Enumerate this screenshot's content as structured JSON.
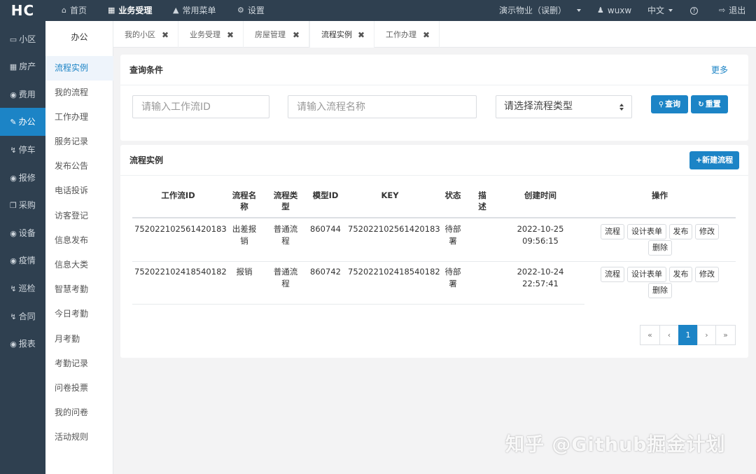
{
  "app": {
    "logo": "HC"
  },
  "topnav": {
    "home": "首页",
    "business": "业务受理",
    "common_menu": "常用菜单",
    "settings": "设置",
    "company": "演示物业（误删）",
    "user": "wuxw",
    "language": "中文",
    "logout": "退出"
  },
  "sidebar": {
    "items": [
      {
        "label": "小区",
        "icon": "monitor-icon"
      },
      {
        "label": "房产",
        "icon": "grid-icon"
      },
      {
        "label": "费用",
        "icon": "globe-icon"
      },
      {
        "label": "办公",
        "icon": "edit-icon"
      },
      {
        "label": "停车",
        "icon": "bolt-icon"
      },
      {
        "label": "报修",
        "icon": "globe-icon"
      },
      {
        "label": "采购",
        "icon": "copy-icon"
      },
      {
        "label": "设备",
        "icon": "globe-icon"
      },
      {
        "label": "疫情",
        "icon": "globe-icon"
      },
      {
        "label": "巡检",
        "icon": "bolt-icon"
      },
      {
        "label": "合同",
        "icon": "bolt-icon"
      },
      {
        "label": "报表",
        "icon": "globe-icon"
      }
    ],
    "active": "办公"
  },
  "submenu": {
    "title": "办公",
    "items": [
      "流程实例",
      "我的流程",
      "工作办理",
      "服务记录",
      "发布公告",
      "电话投诉",
      "访客登记",
      "信息发布",
      "信息大类",
      "智慧考勤",
      "今日考勤",
      "月考勤",
      "考勤记录",
      "问卷投票",
      "我的问卷",
      "活动规则"
    ],
    "active": "流程实例"
  },
  "tabs": [
    "我的小区",
    "业务受理",
    "房屋管理",
    "流程实例",
    "工作办理"
  ],
  "active_tab": "流程实例",
  "query": {
    "title": "查询条件",
    "more": "更多",
    "workflow_id_placeholder": "请输入工作流ID",
    "workflow_name_placeholder": "请输入流程名称",
    "workflow_type_select": "请选择流程类型",
    "search_button": "查询",
    "reset_button": "重置"
  },
  "list": {
    "title": "流程实例",
    "new_button": "+新建流程",
    "columns": [
      "工作流ID",
      "流程名称",
      "流程类型",
      "模型ID",
      "KEY",
      "状态",
      "描述",
      "创建时间",
      "操作"
    ],
    "rows": [
      {
        "workflow_id": "752022102561420183",
        "name": "出差报销",
        "type": "普通流程",
        "model_id": "860744",
        "key": "752022102561420183",
        "status": "待部署",
        "description": "",
        "created_date": "2022-10-25",
        "created_time": "09:56:15"
      },
      {
        "workflow_id": "752022102418540182",
        "name": "报销",
        "type": "普通流程",
        "model_id": "860742",
        "key": "752022102418540182",
        "status": "待部署",
        "description": "",
        "created_date": "2022-10-24",
        "created_time": "22:57:41"
      }
    ],
    "actions": [
      "流程",
      "设计表单",
      "发布",
      "修改",
      "删除"
    ]
  },
  "pagination": {
    "first": "«",
    "prev": "‹",
    "current": "1",
    "next": "›",
    "last": "»"
  },
  "watermark": "知乎 @Github掘金计划",
  "colors": {
    "nav_bg": "#2f4050",
    "accent": "#1c84c6",
    "page_bg": "#f3f3f4"
  }
}
